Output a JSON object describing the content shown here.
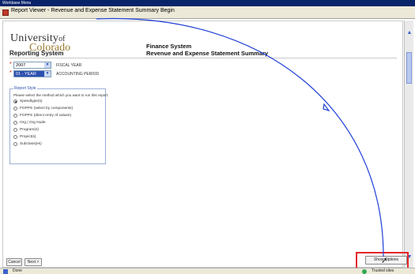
{
  "window": {
    "top_title": "Workbase Menu",
    "header_title": "Report Viewer - Revenue and Expense Statement Summary Begin"
  },
  "branding": {
    "logo_university": "University",
    "logo_of": "of",
    "logo_colorado": "Colorado",
    "system_label": "Reporting System",
    "header_line1": "Finance System",
    "header_line2": "Revenue and Expense Statement Summary"
  },
  "parameters": [
    {
      "value": "2007",
      "label": "FISCAL YEAR",
      "required_mark": "*"
    },
    {
      "value": "01 - YEAR",
      "label": "ACCOUNTING PERIOD",
      "required_mark": "*"
    }
  ],
  "report_style": {
    "legend": "Report Style",
    "instructions": "Please select the method which you want to run this report:",
    "options": [
      {
        "label": "Speedtype(s)",
        "selected": true
      },
      {
        "label": "FOPPS (select by components)",
        "selected": false
      },
      {
        "label": "FOPPS (direct entry of values)",
        "selected": false
      },
      {
        "label": "Org | Org Node",
        "selected": false
      },
      {
        "label": "Program(s)",
        "selected": false
      },
      {
        "label": "Project(s)",
        "selected": false
      },
      {
        "label": "Subclass(es)",
        "selected": false
      }
    ]
  },
  "buttons": {
    "cancel": "Cancel",
    "next": "Next >",
    "show_options": "Show Options"
  },
  "status": {
    "left": "Done",
    "right": "Trusted sites"
  },
  "colors": {
    "highlight": "#e3272c",
    "annotation_curve": "#1f3fd6",
    "selected_dropdown": "#2c4fb0",
    "logo_gold": "#9a7a2d"
  },
  "icons": [
    "report-app-icon",
    "cursor-icon",
    "scroll-up-icon",
    "scroll-down-icon",
    "trusted-sites-icon"
  ]
}
